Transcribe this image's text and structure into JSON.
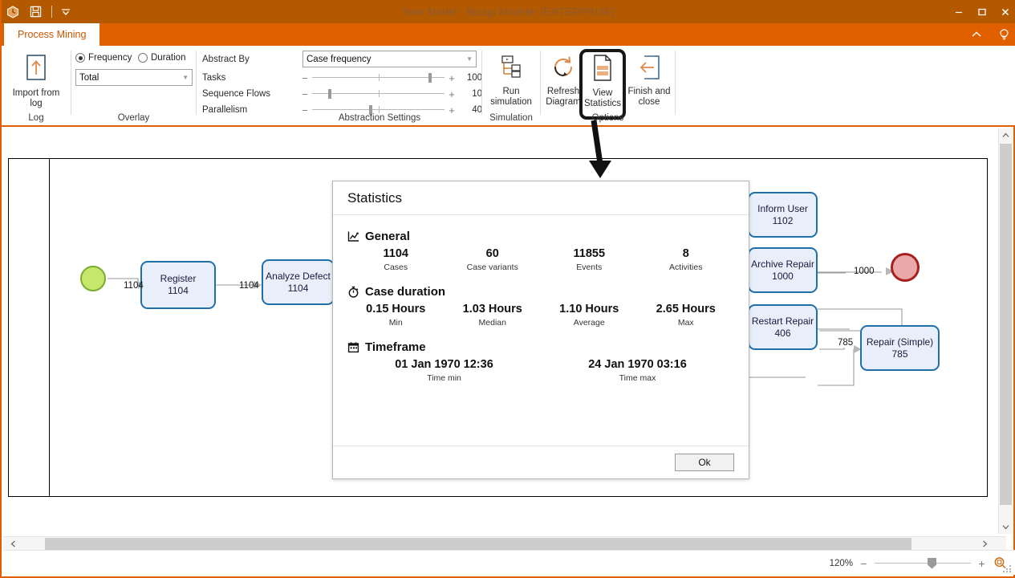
{
  "window": {
    "title": "New Model - Bizagi Modeler [ENTERPRISE]",
    "quick_access": [
      {
        "name": "bizagi-logo-icon",
        "label": "Bizagi"
      },
      {
        "name": "save-icon",
        "label": "Save"
      },
      {
        "name": "customize-quick-access-caret-icon",
        "label": "Customize Quick Access Toolbar"
      }
    ],
    "controls": [
      {
        "name": "minimize-button",
        "label": "Minimize"
      },
      {
        "name": "maximize-button",
        "label": "Maximize"
      },
      {
        "name": "close-button",
        "label": "Close"
      }
    ]
  },
  "ribbon": {
    "tab": "Process Mining",
    "right_icons": [
      {
        "name": "collapse-ribbon-icon",
        "label": "Collapse Ribbon"
      },
      {
        "name": "help-bulb-icon",
        "label": "Help"
      }
    ],
    "groups": {
      "log": {
        "label": "Log",
        "import_button": {
          "line1": "Import from",
          "line2": "log"
        }
      },
      "overlay": {
        "label": "Overlay",
        "radio_frequency": "Frequency",
        "radio_duration": "Duration",
        "radio_selected": "Frequency",
        "measure_value": "Total"
      },
      "abstraction": {
        "label": "Abstraction Settings",
        "abstract_by_label": "Abstract By",
        "abstract_by_value": "Case frequency",
        "sliders": [
          {
            "label": "Tasks",
            "value": "100",
            "pct": 88
          },
          {
            "label": "Sequence Flows",
            "value": "10",
            "pct": 12
          },
          {
            "label": "Parallelism",
            "value": "40",
            "pct": 43
          }
        ]
      },
      "simulation": {
        "label": "Simulation",
        "run_button": {
          "line1": "Run",
          "line2": "simulation"
        }
      },
      "options": {
        "label": "Options",
        "refresh_button": {
          "line1": "Refresh",
          "line2": "Diagram"
        },
        "view_statistics_button": {
          "line1": "View",
          "line2": "Statistics"
        },
        "finish_button": {
          "line1": "Finish and",
          "line2": "close"
        }
      }
    }
  },
  "diagram": {
    "nodes": [
      {
        "name": "Register",
        "count": "1104"
      },
      {
        "name": "Analyze Defect",
        "count": "1104"
      },
      {
        "name": "Inform User",
        "count": "1102"
      },
      {
        "name": "Archive Repair",
        "count": "1000"
      },
      {
        "name": "Restart Repair",
        "count": "406"
      },
      {
        "name": "Repair (Simple)",
        "count": "785"
      }
    ],
    "flow_labels": [
      "1104",
      "1104",
      "1000",
      "785"
    ],
    "start_event": "start-event",
    "end_event": "end-event"
  },
  "dialog": {
    "title": "Statistics",
    "ok_label": "Ok",
    "sections": [
      {
        "icon": "chart-line-icon",
        "heading": "General",
        "metrics": [
          {
            "value": "1104",
            "label": "Cases"
          },
          {
            "value": "60",
            "label": "Case variants"
          },
          {
            "value": "11855",
            "label": "Events"
          },
          {
            "value": "8",
            "label": "Activities"
          }
        ]
      },
      {
        "icon": "stopwatch-icon",
        "heading": "Case duration",
        "metrics": [
          {
            "value": "0.15 Hours",
            "label": "Min"
          },
          {
            "value": "1.03 Hours",
            "label": "Median"
          },
          {
            "value": "1.10 Hours",
            "label": "Average"
          },
          {
            "value": "2.65 Hours",
            "label": "Max"
          }
        ]
      },
      {
        "icon": "calendar-icon",
        "heading": "Timeframe",
        "metrics": [
          {
            "value": "01 Jan 1970 12:36",
            "label": "Time min"
          },
          {
            "value": "24 Jan 1970 03:16",
            "label": "Time max"
          }
        ]
      }
    ]
  },
  "statusbar": {
    "zoom_percent": "120%",
    "zoom_minus": "−",
    "zoom_plus": "+",
    "fit_icon": "zoom-fit-icon"
  },
  "colors": {
    "titlebar": "#b35900",
    "ribbon": "#e06000",
    "node_fill": "#e8effa",
    "node_border": "#1f6fa8",
    "start_fill": "#c5e86c",
    "end_fill": "#eba8a8"
  }
}
